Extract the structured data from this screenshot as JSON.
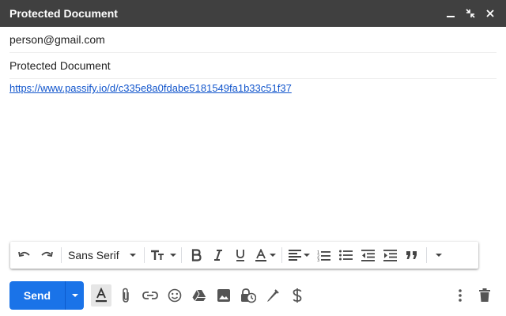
{
  "window": {
    "title": "Protected Document",
    "controls": [
      "minimize-icon",
      "exit-fullscreen-icon",
      "close-icon"
    ]
  },
  "compose": {
    "to": "person@gmail.com",
    "subject": "Protected Document",
    "body_link": "https://www.passify.io/d/c335e8a0fdabe5181549fa1b33c51f37"
  },
  "format_toolbar": {
    "font_family": "Sans Serif",
    "icons": [
      "undo-icon",
      "redo-icon",
      "text-size-icon",
      "bold-icon",
      "italic-icon",
      "underline-icon",
      "text-color-icon",
      "align-icon",
      "numbered-list-icon",
      "bulleted-list-icon",
      "indent-less-icon",
      "indent-more-icon",
      "quote-icon",
      "more-formatting-icon"
    ]
  },
  "bottom_toolbar": {
    "send_label": "Send",
    "icons": [
      "formatting-options-icon",
      "attach-icon",
      "link-icon",
      "emoji-icon",
      "drive-icon",
      "photo-icon",
      "confidential-icon",
      "signature-icon",
      "dollar-icon",
      "more-options-icon",
      "discard-icon"
    ]
  },
  "colors": {
    "titlebar_bg": "#404040",
    "send_blue": "#1a73e8",
    "link_blue": "#1155cc"
  }
}
